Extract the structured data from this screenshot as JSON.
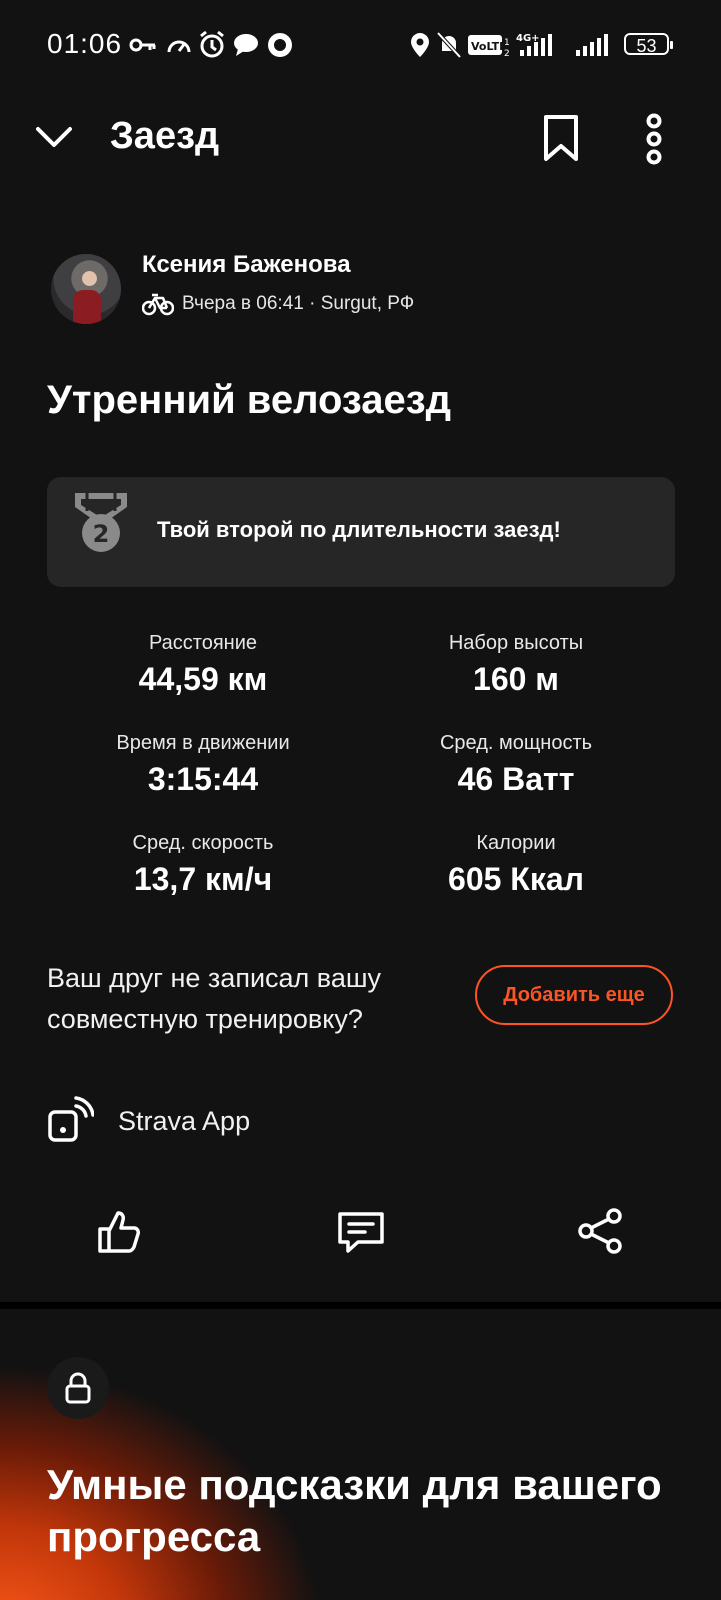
{
  "status_bar": {
    "time": "01:06",
    "battery": "53",
    "icons": [
      "key-icon",
      "speedometer-icon",
      "alarm-icon",
      "chat-icon",
      "messenger-icon",
      "location-icon",
      "bell-off-icon",
      "volte-icon",
      "signal-4g-icon",
      "signal-icon",
      "battery-icon"
    ]
  },
  "header": {
    "title": "Заезд",
    "icons": [
      "chevron-down-icon",
      "bookmark-icon",
      "more-vertical-icon"
    ]
  },
  "athlete": {
    "name": "Ксения Баженова",
    "meta": "Вчера в 06:41 · Surgut, РФ",
    "sport_icon": "bike-icon"
  },
  "activity": {
    "title": "Утренний велозаезд"
  },
  "achievement": {
    "text": "Твой второй по длительности заезд!",
    "medal_number": "2",
    "icon": "medal-icon"
  },
  "stats": [
    {
      "label": "Расстояние",
      "value": "44,59 км"
    },
    {
      "label": "Набор высоты",
      "value": "160 м"
    },
    {
      "label": "Время в движении",
      "value": "3:15:44"
    },
    {
      "label": "Сред. мощность",
      "value": "46 Ватт"
    },
    {
      "label": "Сред. скорость",
      "value": "13,7 км/ч"
    },
    {
      "label": "Калории",
      "value": "605 Ккал"
    }
  ],
  "partner_prompt": {
    "text": "Ваш друг не записал вашу совместную тренировку?",
    "button": "Добавить еще"
  },
  "device": {
    "label": "Strava App",
    "icon": "device-sync-icon"
  },
  "actions": [
    "like-icon",
    "comment-icon",
    "share-icon"
  ],
  "promo": {
    "title": "Умные подсказки для вашего прогресса",
    "icon": "lock-icon"
  },
  "colors": {
    "background": "#121212",
    "card": "#262626",
    "accent": "#fc5423"
  }
}
